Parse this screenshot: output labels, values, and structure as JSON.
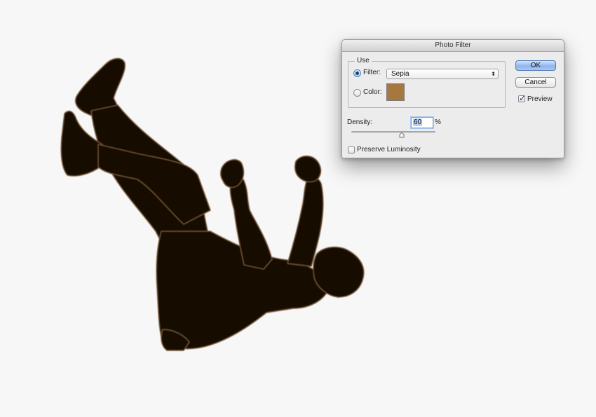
{
  "colors": {
    "filter_swatch": "#a8773f",
    "background": "#f7f7f7",
    "figure_dark": "#120805",
    "figure_edge": "#7a5a3c"
  },
  "dialog": {
    "title": "Photo Filter",
    "use_group": {
      "legend": "Use",
      "filter_option": {
        "label": "Filter:",
        "selected": true,
        "value": "Sepia"
      },
      "color_option": {
        "label": "Color:",
        "selected": false
      }
    },
    "density": {
      "label": "Density:",
      "value": "60",
      "unit": "%",
      "percent": 60
    },
    "preserve_luminosity": {
      "label": "Preserve Luminosity",
      "checked": false
    },
    "buttons": {
      "ok": "OK",
      "cancel": "Cancel"
    },
    "preview": {
      "label": "Preview",
      "checked": true
    }
  },
  "image_subject": "falling-man-silhouette"
}
